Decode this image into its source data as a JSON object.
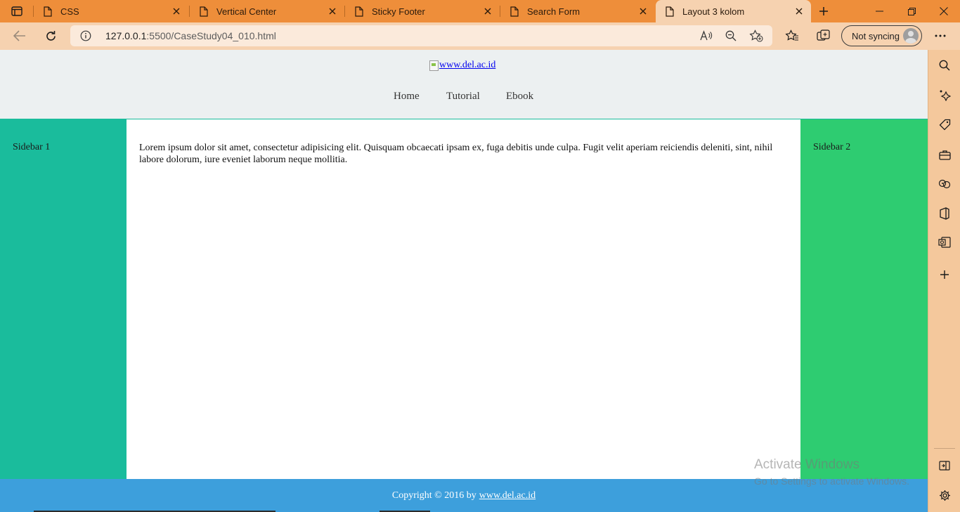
{
  "browser": {
    "tabs": [
      {
        "title": "CSS",
        "active": false
      },
      {
        "title": "Vertical Center",
        "active": false
      },
      {
        "title": "Sticky Footer",
        "active": false
      },
      {
        "title": "Search Form",
        "active": false
      },
      {
        "title": "Layout 3 kolom",
        "active": true
      }
    ],
    "address": {
      "host": "127.0.0.1",
      "path": ":5500/CaseStudy04_010.html"
    },
    "profile_label": "Not syncing",
    "colors": {
      "tabstrip": "#ee8e3a",
      "toolbar": "#f6d2b0",
      "sidebar": "#f4c89c"
    }
  },
  "page": {
    "logo_alt": "www.del.ac.id",
    "nav": [
      "Home",
      "Tutorial",
      "Ebook"
    ],
    "sidebar1": "Sidebar 1",
    "sidebar2": "Sidebar 2",
    "main_text": "Lorem ipsum dolor sit amet, consectetur adipisicing elit. Quisquam obcaecati ipsam ex, fuga debitis unde culpa. Fugit velit aperiam reiciendis deleniti, sint, nihil labore dolorum, iure eveniet laborum neque mollitia.",
    "footer_text": "Copyright © 2016 by",
    "footer_link": "www.del.ac.id",
    "colors": {
      "header": "#ecf0f1",
      "sidebar1": "#1abc9c",
      "sidebar2": "#2ecc71",
      "footer": "#3d9fdc"
    }
  },
  "watermark": {
    "line1": "Activate Windows",
    "line2": "Go to Settings to activate Windows."
  }
}
